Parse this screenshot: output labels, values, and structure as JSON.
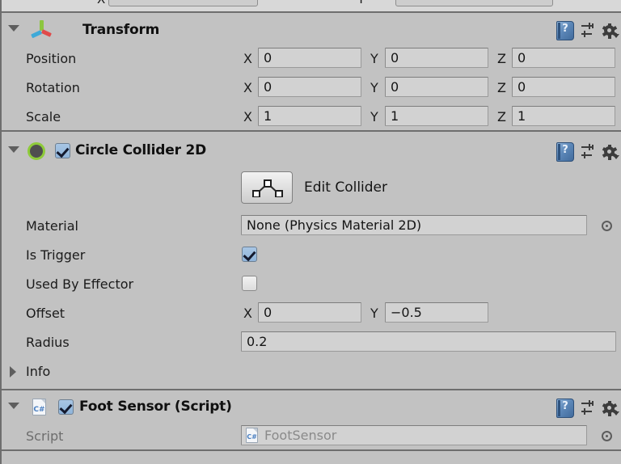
{
  "window": {
    "background_color": "#c2c2c2",
    "field_color": "#d2d2d2",
    "accent_green": "#8ecb3a",
    "checkbox_blue": "#8fb4da"
  },
  "top_partial_row": {
    "x_label": "X",
    "y_label": "Y"
  },
  "components": [
    {
      "id": "transform",
      "title": "Transform",
      "icon": "transform-gizmo-icon",
      "expanded": true,
      "has_enable_checkbox": false,
      "header_icons": [
        "help-book-icon",
        "preset-icon",
        "gear-icon"
      ],
      "rows": [
        {
          "label": "Position",
          "axes": [
            {
              "axis": "X",
              "value": "0"
            },
            {
              "axis": "Y",
              "value": "0"
            },
            {
              "axis": "Z",
              "value": "0"
            }
          ]
        },
        {
          "label": "Rotation",
          "axes": [
            {
              "axis": "X",
              "value": "0"
            },
            {
              "axis": "Y",
              "value": "0"
            },
            {
              "axis": "Z",
              "value": "0"
            }
          ]
        },
        {
          "label": "Scale",
          "axes": [
            {
              "axis": "X",
              "value": "1"
            },
            {
              "axis": "Y",
              "value": "1"
            },
            {
              "axis": "Z",
              "value": "1"
            }
          ]
        }
      ]
    },
    {
      "id": "circle-collider-2d",
      "title": "Circle Collider 2D",
      "icon": "circle-collider-icon",
      "expanded": true,
      "enabled": true,
      "header_icons": [
        "help-book-icon",
        "preset-icon",
        "gear-icon"
      ],
      "edit_collider": {
        "button_icon": "polygon-edit-icon",
        "label": "Edit Collider"
      },
      "material": {
        "label": "Material",
        "value": "None (Physics Material 2D)",
        "picker": "object-picker-icon"
      },
      "is_trigger": {
        "label": "Is Trigger",
        "checked": true
      },
      "used_by_effector": {
        "label": "Used By Effector",
        "checked": false
      },
      "offset": {
        "label": "Offset",
        "axes": [
          {
            "axis": "X",
            "value": "0"
          },
          {
            "axis": "Y",
            "value": "−0.5"
          }
        ]
      },
      "radius": {
        "label": "Radius",
        "value": "0.2"
      },
      "info": {
        "label": "Info",
        "expanded": false
      }
    },
    {
      "id": "foot-sensor-script",
      "title": "Foot Sensor (Script)",
      "icon": "csharp-script-icon",
      "expanded": true,
      "enabled": true,
      "header_icons": [
        "help-book-icon",
        "preset-icon",
        "gear-icon"
      ],
      "script_row": {
        "label": "Script",
        "value": "FootSensor",
        "value_icon": "csharp-script-icon",
        "picker": "object-picker-icon",
        "disabled": true
      }
    }
  ]
}
